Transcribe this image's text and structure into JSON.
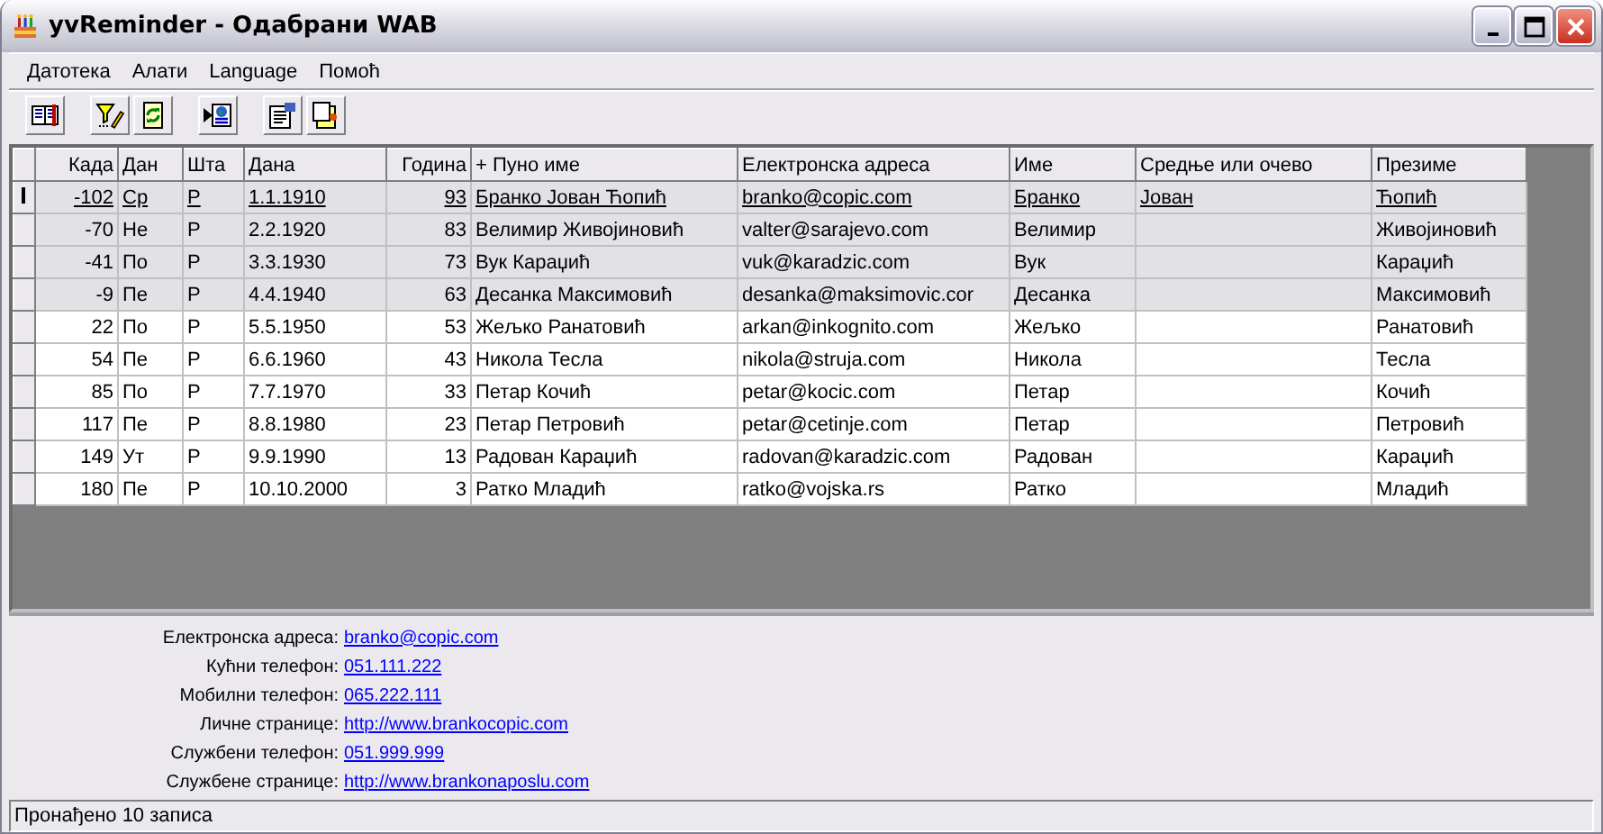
{
  "window": {
    "title": "yvReminder - Одабрани WAB"
  },
  "menu": [
    {
      "label": "Датотека"
    },
    {
      "label": "Алати"
    },
    {
      "label": "Language"
    },
    {
      "label": "Помоћ"
    }
  ],
  "toolbar": [
    {
      "kind": "book"
    },
    {
      "kind": "filter"
    },
    {
      "kind": "refresh"
    },
    {
      "kind": "globe"
    },
    {
      "kind": "properties"
    },
    {
      "kind": "newdoc"
    }
  ],
  "table": {
    "columns": [
      "Када",
      "Дан",
      "Шта",
      "Дана",
      "Година",
      "+ Пуно име",
      "Електронска адреса",
      "Име",
      "Средње или очево",
      "Презиме"
    ],
    "rows": [
      {
        "selected": true,
        "past": true,
        "when": "-102",
        "day": "Ср",
        "what": "Р",
        "date": "1.1.1910",
        "years": "93",
        "full_name": "Бранко Јован Ћопић",
        "email": "branko@copic.com",
        "first_name": "Бранко",
        "middle_name": "Јован",
        "last_name": "Ћопић"
      },
      {
        "selected": false,
        "past": true,
        "when": "-70",
        "day": "Не",
        "what": "Р",
        "date": "2.2.1920",
        "years": "83",
        "full_name": "Велимир Живојиновић",
        "email": "valter@sarajevo.com",
        "first_name": "Велимир",
        "last_name": "Живојиновић"
      },
      {
        "selected": false,
        "past": true,
        "when": "-41",
        "day": "По",
        "what": "Р",
        "date": "3.3.1930",
        "years": "73",
        "full_name": "Вук Караџић",
        "email": "vuk@karadzic.com",
        "first_name": "Вук",
        "last_name": "Караџић"
      },
      {
        "selected": false,
        "past": true,
        "when": "-9",
        "day": "Пе",
        "what": "Р",
        "date": "4.4.1940",
        "years": "63",
        "full_name": "Десанка Максимовић",
        "email": "desanka@maksimovic.cor",
        "first_name": "Десанка",
        "last_name": "Максимовић"
      },
      {
        "selected": false,
        "past": false,
        "when": "22",
        "day": "По",
        "what": "Р",
        "date": "5.5.1950",
        "years": "53",
        "full_name": "Жељко Ранатовић",
        "email": "arkan@inkognito.com",
        "first_name": "Жељко",
        "last_name": "Ранатовић"
      },
      {
        "selected": false,
        "past": false,
        "when": "54",
        "day": "Пе",
        "what": "Р",
        "date": "6.6.1960",
        "years": "43",
        "full_name": "Никола Тесла",
        "email": "nikola@struja.com",
        "first_name": "Никола",
        "last_name": "Тесла"
      },
      {
        "selected": false,
        "past": false,
        "when": "85",
        "day": "По",
        "what": "Р",
        "date": "7.7.1970",
        "years": "33",
        "full_name": "Петар Кочић",
        "email": "petar@kocic.com",
        "first_name": "Петар",
        "last_name": "Кочић"
      },
      {
        "selected": false,
        "past": false,
        "when": "117",
        "day": "Пе",
        "what": "Р",
        "date": "8.8.1980",
        "years": "23",
        "full_name": "Петар Петровић",
        "email": "petar@cetinje.com",
        "first_name": "Петар",
        "last_name": "Петровић"
      },
      {
        "selected": false,
        "past": false,
        "when": "149",
        "day": "Ут",
        "what": "Р",
        "date": "9.9.1990",
        "years": "13",
        "full_name": "Радован Караџић",
        "email": "radovan@karadzic.com",
        "first_name": "Радован",
        "last_name": "Караџић"
      },
      {
        "selected": false,
        "past": false,
        "when": "180",
        "day": "Пе",
        "what": "Р",
        "date": "10.10.2000",
        "years": "3",
        "full_name": "Ратко Младић",
        "email": "ratko@vojska.rs",
        "first_name": "Ратко",
        "last_name": "Младић"
      }
    ]
  },
  "details": [
    {
      "label": "Електронска адреса:",
      "value": "branko@copic.com"
    },
    {
      "label": "Кућни телефон:",
      "value": "051.111.222"
    },
    {
      "label": "Мобилни телефон:",
      "value": "065.222.111"
    },
    {
      "label": "Личне странице:",
      "value": "http://www.brankocopic.com"
    },
    {
      "label": "Службени телефон:",
      "value": "051.999.999"
    },
    {
      "label": "Службене странице:",
      "value": "http://www.brankonaposlu.com"
    }
  ],
  "status_bar": "Пронађено 10 записа"
}
